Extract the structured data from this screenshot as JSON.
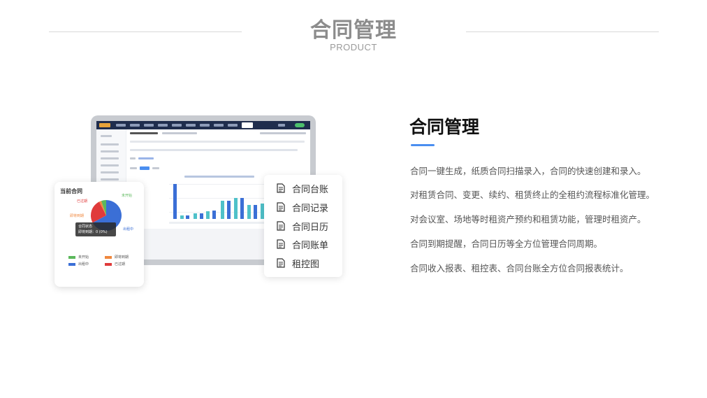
{
  "header": {
    "title": "合同管理",
    "subtitle": "PRODUCT"
  },
  "donut_card": {
    "title": "当前合同",
    "labels": {
      "expired": "已过期",
      "not_started": "未开始",
      "expiring_soon": "即将到期",
      "in_lease": "出租中"
    },
    "tooltip": {
      "line1": "合同状态",
      "line2": "即将到期：0 (0%)"
    },
    "legend": [
      {
        "label": "未开始",
        "color": "#5cb85c"
      },
      {
        "label": "即将到期",
        "color": "#f0883e"
      },
      {
        "label": "出租中",
        "color": "#3b6fd6"
      },
      {
        "label": "已过期",
        "color": "#e03b3b"
      }
    ]
  },
  "menu": {
    "items": [
      {
        "label": "合同台账",
        "icon": "document-icon"
      },
      {
        "label": "合同记录",
        "icon": "document-icon"
      },
      {
        "label": "合同日历",
        "icon": "document-icon"
      },
      {
        "label": "合同账单",
        "icon": "document-icon"
      },
      {
        "label": "租控图",
        "icon": "document-icon"
      }
    ]
  },
  "right": {
    "title": "合同管理",
    "lines": [
      "合同一键生成，纸质合同扫描录入，合同的快速创建和录入。",
      "对租赁合同、变更、续约、租赁终止的全租约流程标准化管理。",
      "对会议室、场地等时租资产预约和租赁功能，管理时租资产。",
      "合同到期提醒，合同日历等全方位管理合同周期。",
      "合同收入报表、租控表、合同台账全方位合同报表统计。"
    ]
  },
  "colors": {
    "accent": "#4a8ef0",
    "bar_blue": "#3b6fd6",
    "bar_teal": "#4fc1c9"
  }
}
